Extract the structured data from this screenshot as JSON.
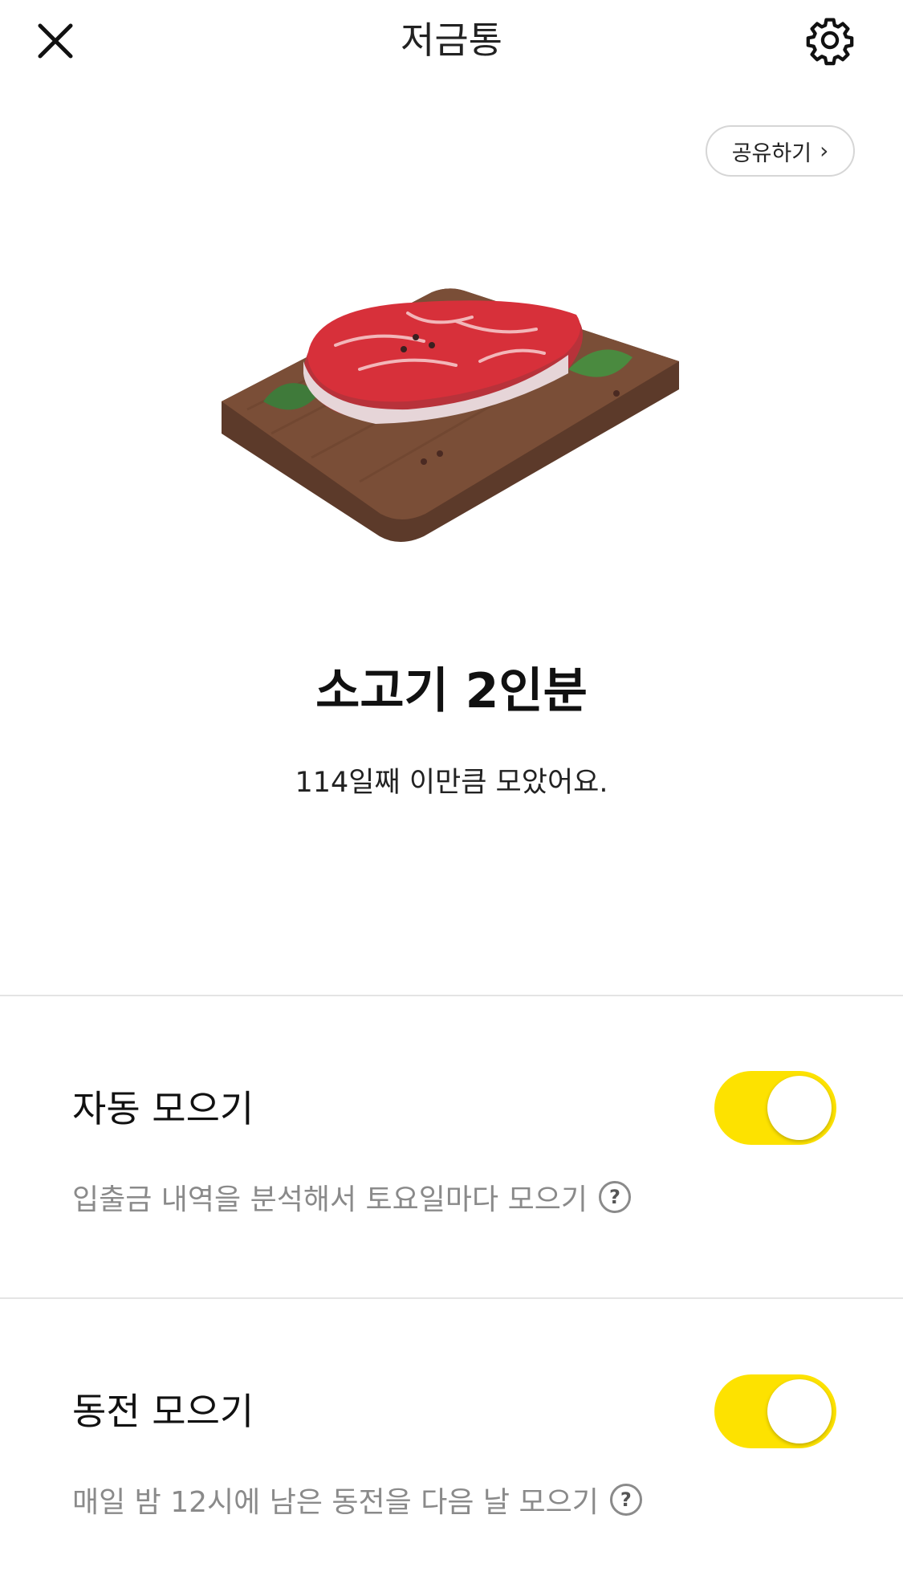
{
  "header": {
    "title": "저금통",
    "close_icon": "close-icon",
    "settings_icon": "gear-icon"
  },
  "share": {
    "label": "공유하기"
  },
  "goal": {
    "illustration": "meat-on-cutting-board",
    "title": "소고기 2인분",
    "subtitle": "114일째 이만큼 모았어요."
  },
  "options": [
    {
      "label": "자동 모으기",
      "description": "입출금 내역을 분석해서 토요일마다 모으기",
      "enabled": true
    },
    {
      "label": "동전 모으기",
      "description": "매일 밤 12시에 남은 동전을 다음 날 모으기",
      "enabled": true
    }
  ],
  "colors": {
    "toggle_on": "#fde200",
    "desc_text": "#8a8a8a"
  }
}
